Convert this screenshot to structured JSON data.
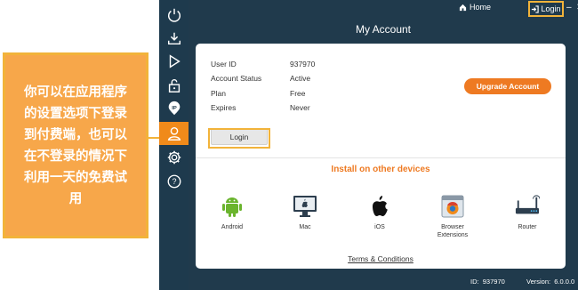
{
  "callout": {
    "lines": [
      "你可以在应用程序",
      "的设置选项下登录",
      "到付费端，也可以",
      "在不登录的情况下",
      "利用一天的免费试",
      "用"
    ]
  },
  "titlebar": {
    "home_label": "Home",
    "login_label": "Login",
    "home_icon": "home-icon",
    "login_icon": "sign-in-icon"
  },
  "sidebar": {
    "items": [
      {
        "icon": "power-icon"
      },
      {
        "icon": "download-icon"
      },
      {
        "icon": "play-icon"
      },
      {
        "icon": "lock-icon"
      },
      {
        "icon": "ip-icon",
        "text": "IP"
      },
      {
        "icon": "account-icon"
      },
      {
        "icon": "gear-icon"
      },
      {
        "icon": "help-icon",
        "text": "?"
      }
    ]
  },
  "page": {
    "title": "My Account"
  },
  "account": {
    "rows": [
      {
        "label": "User ID",
        "value": "937970"
      },
      {
        "label": "Account Status",
        "value": "Active"
      },
      {
        "label": "Plan",
        "value": "Free"
      },
      {
        "label": "Expires",
        "value": "Never"
      }
    ],
    "upgrade_label": "Upgrade Account",
    "login_label": "Login"
  },
  "install": {
    "title": "Install on other devices",
    "devices": [
      {
        "label": "Android",
        "icon": "android-icon"
      },
      {
        "label": "Mac",
        "icon": "mac-icon"
      },
      {
        "label": "iOS",
        "icon": "apple-icon"
      },
      {
        "label": "Browser Extensions",
        "icon": "browser-icon"
      },
      {
        "label": "Router",
        "icon": "router-icon"
      }
    ]
  },
  "terms_label": "Terms & Conditions",
  "footer": {
    "id_label": "ID:",
    "id_value": "937970",
    "version_label": "Version:",
    "version_value": "6.0.0.0"
  },
  "colors": {
    "accent": "#ee7a22",
    "callout_bg": "#f7a74a",
    "callout_border": "#f2b33a",
    "app_bg": "#203a4c"
  }
}
